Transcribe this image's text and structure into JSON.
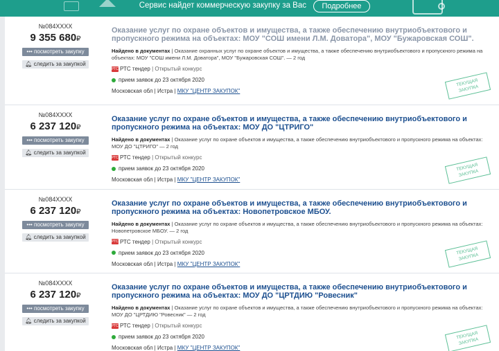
{
  "banner": {
    "text": "Сервис найдет коммерческую закупку за Вас",
    "button_label": "Подробнее"
  },
  "colors": {
    "accent": "#1e9e8c",
    "title": "#1c4f8f",
    "title_viewed": "#8a96a8",
    "status_green": "#2eaa3a"
  },
  "cards": [
    {
      "number": "№084XXXX",
      "price": "9 355 680",
      "currency": "₽",
      "view_label": "••• посмотреть закупку",
      "watch_label": "следить за закупкой",
      "title": "Оказание услуг по охране объектов и имущества, а также обеспечению внутриобъектового и пропускного режима на объектах: МОУ \"СОШ имени Л.М. Доватора\", МОУ \"Бужаровская СОШ\".",
      "found_label": "Найдено в документах",
      "found_text": " | Оказание охранных услуг по охране объектов и имущества, а также обеспечению внутриобъектового и пропускного режима на объектах: МОУ \"СОШ имени Л.М. Доватора\", МОУ \"Бужаровская СОШ\". — 2 год",
      "platform_logo": "РТС",
      "platform": "РТС тендер",
      "kind": " | Открытый конкурс",
      "deadline": "прием заявок до 23 октября 2020",
      "region": "Московская обл | Истра | ",
      "customer": "МКУ \"ЦЕНТР ЗАКУПОК\"",
      "stamp": "ТЕКУЩАЯ ЗАКУПКА"
    },
    {
      "number": "№084XXXX",
      "price": "6 237 120",
      "currency": "₽",
      "view_label": "••• посмотреть закупку",
      "watch_label": "следить за закупкой",
      "title": "Оказание услуг по охране объектов и имущества, а также обеспечению внутриобъектового и пропускного режима на объектах: МОУ ДО \"ЦТРИГО\"",
      "found_label": "Найдено в документах",
      "found_text": " | Оказание услуг по охране объектов и имущества, а также обеспечению внутриобъектового и пропускного режима на объектах: МОУ ДО \"ЦТРИГО\" — 2 год",
      "platform_logo": "РТС",
      "platform": "РТС тендер",
      "kind": " | Открытый конкурс",
      "deadline": "прием заявок до 23 октября 2020",
      "region": "Московская обл | Истра | ",
      "customer": "МКУ \"ЦЕНТР ЗАКУПОК\"",
      "stamp": "ТЕКУЩАЯ ЗАКУПКА"
    },
    {
      "number": "№084XXXX",
      "price": "6 237 120",
      "currency": "₽",
      "view_label": "••• посмотреть закупку",
      "watch_label": "следить за закупкой",
      "title": "Оказание услуг по охране объектов и имущества, а также обеспечению внутриобъектового и пропускного режима на объектах: Новопетровское МБОУ.",
      "found_label": "Найдено в документах",
      "found_text": " | Оказание услуг по охране объектов и имущества, а также обеспечению внутриобъектового и пропускного режима на объектах: Новопетровское МБОУ. — 2 год",
      "platform_logo": "РТС",
      "platform": "РТС тендер",
      "kind": " | Открытый конкурс",
      "deadline": "прием заявок до 23 октября 2020",
      "region": "Московская обл | Истра | ",
      "customer": "МКУ \"ЦЕНТР ЗАКУПОК\"",
      "stamp": "ТЕКУЩАЯ ЗАКУПКА"
    },
    {
      "number": "№084XXXX",
      "price": "6 237 120",
      "currency": "₽",
      "view_label": "••• посмотреть закупку",
      "watch_label": "следить за закупкой",
      "title": "Оказание услуг по охране объектов и имущества, а также обеспечению внутриобъектового и пропускного режима на объектах: МОУ ДО \"ЦРТДИЮ \"Ровесник\"",
      "found_label": "Найдено в документах",
      "found_text": " | Оказание услуг по охране объектов и имущества, а также обеспечению внутриобъектового и пропускного режима на объектах: МОУ ДО \"ЦРТДИЮ \"Ровесник\" — 2 год",
      "platform_logo": "РТС",
      "platform": "РТС тендер",
      "kind": " | Открытый конкурс",
      "deadline": "прием заявок до 23 октября 2020",
      "region": "Московская обл | Истра | ",
      "customer": "МКУ \"ЦЕНТР ЗАКУПОК\"",
      "stamp": "ТЕКУЩАЯ ЗАКУПКА"
    }
  ]
}
